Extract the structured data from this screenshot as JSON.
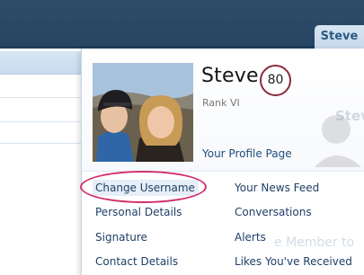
{
  "nav": {
    "user_tab": "Steve"
  },
  "popup": {
    "user_name": "Steve",
    "rank_number": "80",
    "rank_title": "Rank VI",
    "profile_link": "Your Profile Page",
    "ghost_name": "Stev",
    "ghost_footer": "e Member to"
  },
  "menu": {
    "left": [
      "Change Username",
      "Personal Details",
      "Signature",
      "Contact Details"
    ],
    "right": [
      "Your News Feed",
      "Conversations",
      "Alerts",
      "Likes You've Received"
    ]
  },
  "colors": {
    "nav_bar": "#2b4a68",
    "link": "#1f3f66",
    "annotation": "#d12f6c",
    "badge_ring": "#8a2a3c"
  }
}
